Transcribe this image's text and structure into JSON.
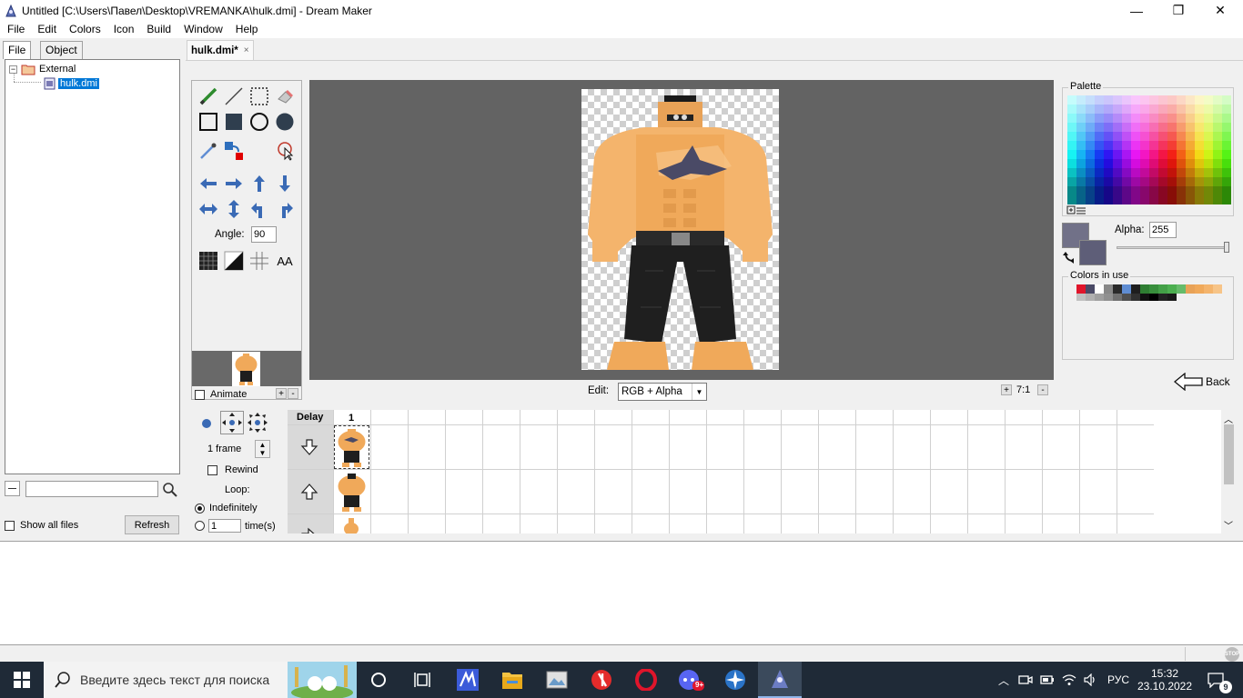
{
  "window": {
    "title": "Untitled [C:\\Users\\Павел\\Desktop\\VREMANKA\\hulk.dmi] - Dream Maker",
    "minimize_glyph": "—",
    "maximize_glyph": "❐",
    "close_glyph": "✕"
  },
  "menu": [
    "File",
    "Edit",
    "Colors",
    "Icon",
    "Build",
    "Window",
    "Help"
  ],
  "left_panel": {
    "tabs": [
      "File",
      "Object"
    ],
    "tree": {
      "root_label": "External",
      "child_label": "hulk.dmi"
    },
    "search_placeholder": "",
    "show_all_files_label": "Show all files",
    "refresh_label": "Refresh"
  },
  "document_tab": {
    "label": "hulk.dmi*",
    "close_glyph": "×"
  },
  "tools": {
    "angle_label": "Angle:",
    "angle_value": "90",
    "aa_label": "AA",
    "animate_label": "Animate",
    "plus": "+",
    "minus": "-"
  },
  "canvas": {
    "edit_label": "Edit:",
    "edit_mode": "RGB + Alpha",
    "zoom_label": "7:1",
    "zoom_in": "+",
    "zoom_out": "-"
  },
  "palette": {
    "title": "Palette",
    "alpha_label": "Alpha:",
    "alpha_value": "255",
    "colors_in_use_title": "Colors in use",
    "back_label": "Back",
    "foreground_color": "#717188",
    "background_color": "#5e5e78"
  },
  "animation": {
    "frames_label": "1 frame",
    "rewind_label": "Rewind",
    "loop_label": "Loop:",
    "indefinitely_label": "Indefinitely",
    "times_value": "1",
    "times_label": "time(s)"
  },
  "grid": {
    "delay_header": "Delay",
    "column_header": "1"
  },
  "taskbar": {
    "search_placeholder": "Введите здесь текст для поиска",
    "language": "РУС",
    "time": "15:32",
    "date": "23.10.2022",
    "notification_count": "9",
    "badge": "9+"
  },
  "statusbar": {
    "stop_label": "STOP"
  }
}
